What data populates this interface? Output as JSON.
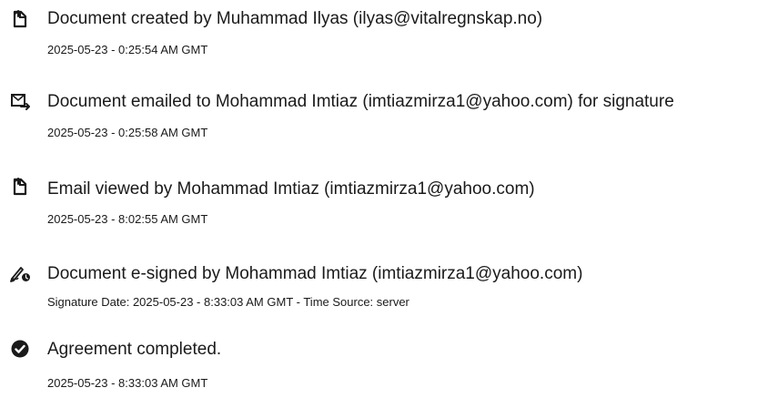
{
  "events": [
    {
      "icon": "document-created-icon",
      "title": "Document created by Muhammad Ilyas (ilyas@vitalregnskap.no)",
      "meta": "2025-05-23 - 0:25:54 AM GMT"
    },
    {
      "icon": "document-emailed-icon",
      "title": "Document emailed to Mohammad Imtiaz (imtiazmirza1@yahoo.com) for signature",
      "meta": "2025-05-23 - 0:25:58 AM GMT"
    },
    {
      "icon": "email-viewed-icon",
      "title": "Email viewed by Mohammad Imtiaz (imtiazmirza1@yahoo.com)",
      "meta": "2025-05-23 - 8:02:55 AM GMT"
    },
    {
      "icon": "e-signed-icon",
      "title": "Document e-signed by Mohammad Imtiaz (imtiazmirza1@yahoo.com)",
      "meta": "Signature Date: 2025-05-23 - 8:33:03 AM GMT - Time Source: server"
    },
    {
      "icon": "check-circle-icon",
      "title": "Agreement completed.",
      "meta": "2025-05-23 - 8:33:03 AM GMT"
    }
  ]
}
